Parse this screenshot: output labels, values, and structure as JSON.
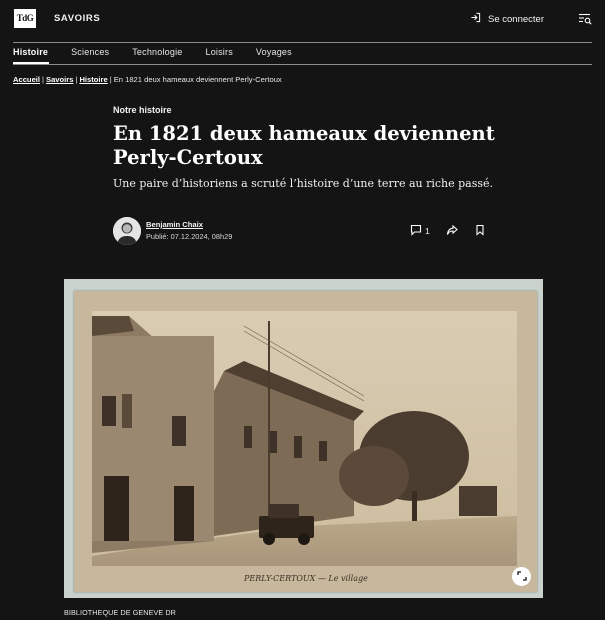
{
  "header": {
    "logo_text": "TdG",
    "section": "SAVOIRS",
    "login_label": "Se connecter",
    "login_icon": "login-icon",
    "menu_icon": "menu-search-icon"
  },
  "nav": {
    "items": [
      "Histoire",
      "Sciences",
      "Technologie",
      "Loisirs",
      "Voyages"
    ],
    "active": "Histoire"
  },
  "breadcrumb": {
    "items": [
      "Accueil",
      "Savoirs",
      "Histoire"
    ],
    "current": "En 1821 deux hameaux deviennent Perly-Certoux",
    "separator": "|"
  },
  "article": {
    "kicker": "Notre histoire",
    "title": "En 1821 deux hameaux deviennent Perly-Certoux",
    "lede": "Une paire d’historiens a scruté l’histoire d’une terre au riche passé.",
    "author": "Benjamin Chaix",
    "published": "Publié: 07.12.2024, 08h29",
    "comments_count": "1",
    "icons": [
      "comment-icon",
      "share-icon",
      "bookmark-icon"
    ]
  },
  "image": {
    "caption_on_card": "PERLY-CERTOUX — Le village",
    "credit": "BIBLIOTHEQUE DE GENEVE DR",
    "expand_icon": "expand-icon"
  },
  "colors": {
    "background": "#141414",
    "text": "#f2f2f2",
    "rule": "#8c8c8c",
    "sepia": "#c7b79c"
  }
}
